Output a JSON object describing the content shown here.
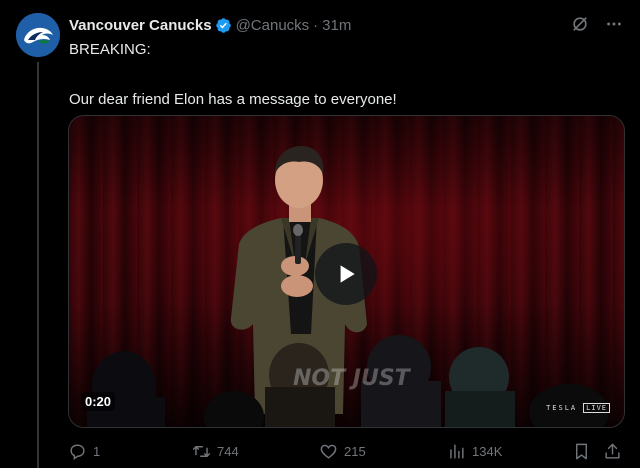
{
  "tweet": {
    "author": {
      "display_name": "Vancouver Canucks",
      "handle": "@Canucks",
      "verified": true,
      "avatar_icon": "canucks-orca-logo"
    },
    "separator": "·",
    "time": "31m",
    "text_line1": "BREAKING:",
    "text_line2": "Our dear friend Elon has a message to everyone!",
    "media": {
      "type": "video",
      "duration": "0:20",
      "watermark": "NOT JUST",
      "brand_left": "TESLA",
      "brand_right": "LIVE"
    },
    "stats": {
      "replies": "1",
      "retweets": "744",
      "likes": "215",
      "views": "134K"
    }
  },
  "colors": {
    "background": "#000000",
    "text": "#e7e9ea",
    "muted": "#71767b",
    "verified": "#1d9bf0",
    "avatar_bg": "#1f5fa8"
  }
}
